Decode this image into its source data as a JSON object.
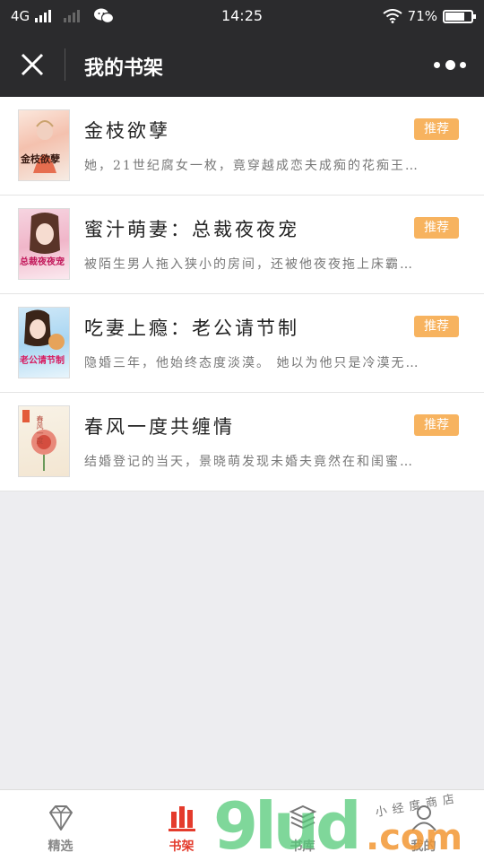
{
  "status_bar": {
    "network": "4G",
    "time": "14:25",
    "battery": "71%"
  },
  "nav": {
    "title": "我的书架"
  },
  "books": [
    {
      "title": "金枝欲孽",
      "desc": "她，21世纪腐女一枚，竟穿越成恋夫成痴的花痴王…",
      "tag": "推荐",
      "cover_text": "金枝欲孽"
    },
    {
      "title": "蜜汁萌妻：总裁夜夜宠",
      "desc": "被陌生男人拖入狭小的房间，还被他夜夜拖上床霸…",
      "tag": "推荐",
      "cover_text": "总裁夜夜宠"
    },
    {
      "title": "吃妻上瘾：老公请节制",
      "desc": "隐婚三年，他始终态度淡漠。 她以为他只是冷漠无…",
      "tag": "推荐",
      "cover_text": "老公请节制"
    },
    {
      "title": "春风一度共缠情",
      "desc": "结婚登记的当天，景晓萌发现未婚夫竟然在和闺蜜…",
      "tag": "推荐",
      "cover_text": "春风一度"
    }
  ],
  "tabs": [
    {
      "label": "精选",
      "icon": "diamond-icon",
      "active": false
    },
    {
      "label": "书架",
      "icon": "bookshelf-icon",
      "active": true
    },
    {
      "label": "书库",
      "icon": "library-icon",
      "active": false
    },
    {
      "label": "我的",
      "icon": "profile-icon",
      "active": false
    }
  ],
  "watermark": {
    "main": "9lud",
    "suffix": ".com",
    "small": "小经度商店"
  },
  "colors": {
    "header_bg": "#2b2b2d",
    "tag_bg": "#f7b35f",
    "active_tab": "#e43b2c",
    "page_bg": "#ededf0"
  }
}
